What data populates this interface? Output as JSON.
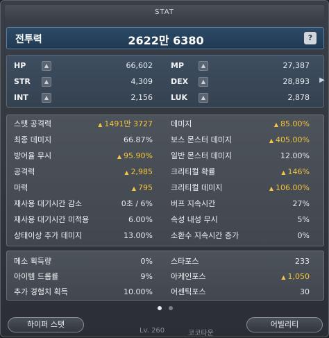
{
  "window": {
    "title": "STAT"
  },
  "power": {
    "label": "전투력",
    "value": "2622만 6380",
    "help": "?"
  },
  "basic": {
    "left": [
      {
        "label": "HP",
        "value": "66,602"
      },
      {
        "label": "STR",
        "value": "4,309"
      },
      {
        "label": "INT",
        "value": "2,156"
      }
    ],
    "right": [
      {
        "label": "MP",
        "value": "27,387"
      },
      {
        "label": "DEX",
        "value": "28,893"
      },
      {
        "label": "LUK",
        "value": "2,878"
      }
    ]
  },
  "detail": {
    "left": [
      {
        "label": "스탯 공격력",
        "value": "1491만 3727",
        "up": true
      },
      {
        "label": "최종 데미지",
        "value": "66.87%",
        "up": false
      },
      {
        "label": "방어율 무시",
        "value": "95.90%",
        "up": true
      },
      {
        "label": "공격력",
        "value": "2,985",
        "up": true
      },
      {
        "label": "마력",
        "value": "795",
        "up": true
      },
      {
        "label": "재사용 대기시간 감소",
        "value": "0초 / 6%",
        "up": false
      },
      {
        "label": "재사용 대기시간 미적용",
        "value": "6.00%",
        "up": false
      },
      {
        "label": "상태이상 추가 데미지",
        "value": "13.00%",
        "up": false
      }
    ],
    "right": [
      {
        "label": "데미지",
        "value": "85.00%",
        "up": true
      },
      {
        "label": "보스 몬스터 데미지",
        "value": "405.00%",
        "up": true
      },
      {
        "label": "일반 몬스터 데미지",
        "value": "12.00%",
        "up": false
      },
      {
        "label": "크리티컬 확률",
        "value": "146%",
        "up": true
      },
      {
        "label": "크리티컬 데미지",
        "value": "106.00%",
        "up": true
      },
      {
        "label": "버프 지속시간",
        "value": "27%",
        "up": false
      },
      {
        "label": "속성 내성 무시",
        "value": "5%",
        "up": false
      },
      {
        "label": "소환수 지속시간 증가",
        "value": "0%",
        "up": false
      }
    ]
  },
  "extra": {
    "left": [
      {
        "label": "메소 획득량",
        "value": "0%",
        "up": false
      },
      {
        "label": "아이템 드롭률",
        "value": "9%",
        "up": false
      },
      {
        "label": "추가 경험치 획득",
        "value": "10.00%",
        "up": false
      }
    ],
    "right": [
      {
        "label": "스타포스",
        "value": "233",
        "up": false
      },
      {
        "label": "아케인포스",
        "value": "1,050",
        "up": true
      },
      {
        "label": "어센틱포스",
        "value": "30",
        "up": false
      }
    ]
  },
  "buttons": {
    "hyper_stat": "하이퍼 스탯",
    "ability": "어빌리티"
  },
  "footer": {
    "level": "Lv. 260",
    "server": "코코타운"
  },
  "icons": {
    "plus": "plus-icon",
    "up_arrow": "up-arrow-icon",
    "side": "chevron-right-icon"
  }
}
